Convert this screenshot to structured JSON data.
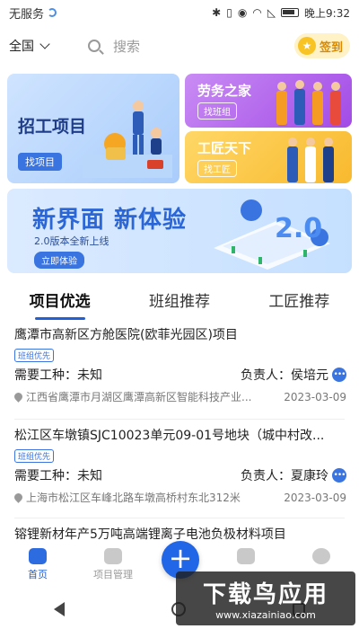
{
  "status_bar": {
    "carrier": "无服务",
    "time": "晚上9:32"
  },
  "top": {
    "region": "全国",
    "search_placeholder": "搜索",
    "signin_label": "签到"
  },
  "cards": {
    "projects": {
      "title": "招工项目",
      "button": "找项目"
    },
    "teams": {
      "title": "劳务之家",
      "button": "找班组"
    },
    "craftsmen": {
      "title": "工匠天下",
      "button": "找工匠"
    }
  },
  "banner": {
    "title": "新界面  新体验",
    "subtitle": "2.0版本全新上线",
    "button": "立即体验",
    "badge": "2.0"
  },
  "tabs": [
    {
      "label": "项目优选",
      "active": true
    },
    {
      "label": "班组推荐",
      "active": false
    },
    {
      "label": "工匠推荐",
      "active": false
    }
  ],
  "items": [
    {
      "title": "鹰潭市高新区方舱医院(欧菲光园区)项目",
      "tag": "班组优先",
      "need": "需要工种：未知",
      "contact": "负责人：侯培元",
      "address": "江西省鹰潭市月湖区鹰潭高新区智能科技产业...",
      "date": "2023-03-09"
    },
    {
      "title": "松江区车墩镇SJC10023单元09-01号地块（城中村改...",
      "tag": "班组优先",
      "need": "需要工种：未知",
      "contact": "负责人：夏康玲",
      "address": "上海市松江区车峰北路车墩高桥村东北312米",
      "date": "2023-03-09"
    },
    {
      "title": "镕锂新材年产5万吨高端锂离子电池负极材料项目"
    }
  ],
  "bottom_nav": {
    "home": "首页",
    "project_mgmt": "项目管理",
    "plus": "+",
    "messages": "",
    "profile": ""
  },
  "watermark": {
    "big": "下载鸟应用",
    "small": "www.xiazainiao.com"
  },
  "colors": {
    "primary": "#1f5fd8",
    "purple_card": "#a24be6",
    "yellow_card": "#f8b92e",
    "signin": "#d98a00"
  }
}
